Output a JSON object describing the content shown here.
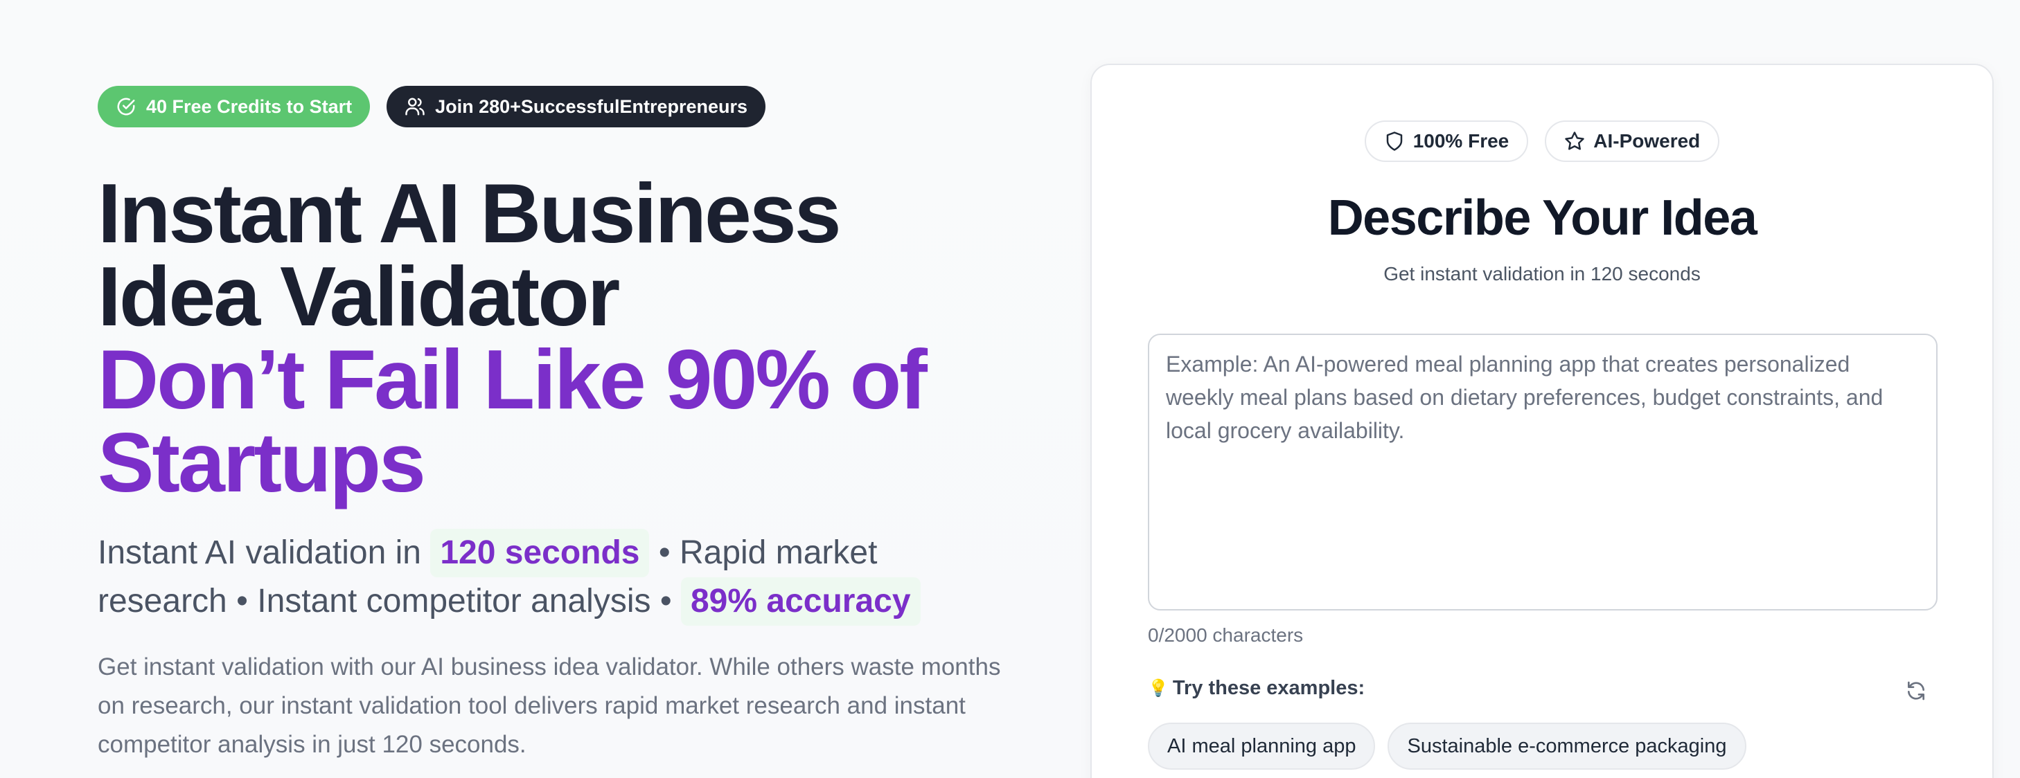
{
  "hero": {
    "badge_credits": "40 Free Credits to Start",
    "badge_join": "Join 280+SuccessfulEntrepreneurs",
    "title_line1": "Instant AI Business",
    "title_line2": "Idea Validator",
    "accent_line1": "Don’t Fail Like 90% of",
    "accent_line2": "Startups",
    "sub_part1": "Instant AI validation in ",
    "sub_highlight1": "120 seconds",
    "sub_part2": " • Rapid market research • Instant competitor analysis • ",
    "sub_highlight2": "89% accuracy",
    "paragraph": "Get instant validation with our AI business idea validator. While others waste months on research, our instant validation tool delivers rapid market research and instant competitor analysis in just 120 seconds."
  },
  "card": {
    "pill_free": "100% Free",
    "pill_ai": "AI-Powered",
    "title": "Describe Your Idea",
    "subtitle": "Get instant validation in 120 seconds",
    "textarea_value": "",
    "textarea_placeholder": "Example: An AI-powered meal planning app that creates personalized weekly meal plans based on dietary preferences, budget constraints, and local grocery availability.",
    "char_count": "0/2000 characters",
    "examples_label": "Try these examples:",
    "examples": [
      "AI meal planning app",
      "Sustainable e-commerce packaging"
    ]
  },
  "icons": {
    "credits": "check-circle-icon",
    "join": "users-icon",
    "free": "shield-icon",
    "ai": "star-icon",
    "examples": "lightbulb-icon",
    "refresh": "refresh-icon"
  },
  "colors": {
    "accent_purple": "#7b2fc9",
    "badge_green": "#5cc670",
    "badge_dark": "#1f2430",
    "highlight_bg": "#eef9f1"
  }
}
